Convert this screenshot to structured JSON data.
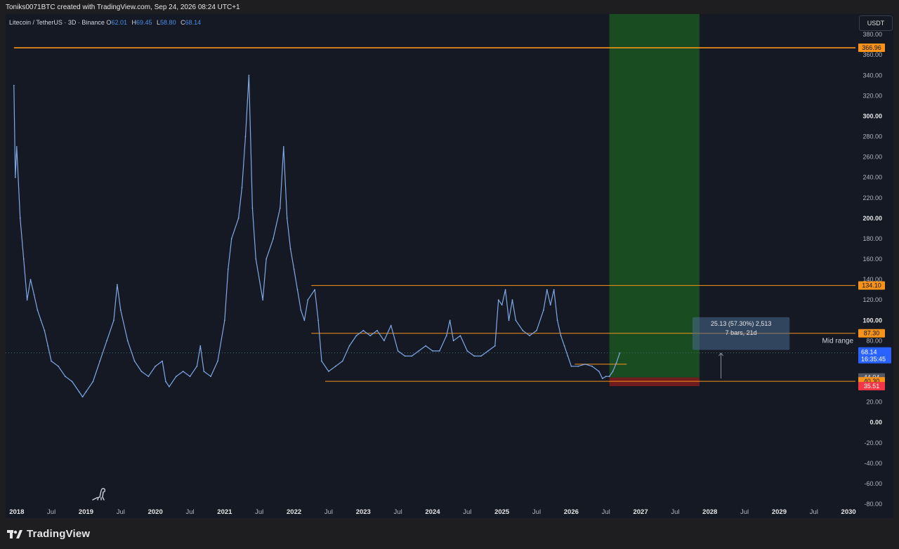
{
  "header": {
    "attribution": "Toniks0071BTC created with TradingView.com, Sep 24, 2026 08:24 UTC+1"
  },
  "legend": {
    "symbol": "Litecoin / TetherUS · 3D · Binance",
    "open_label": "O",
    "open": "62.01",
    "high_label": "H",
    "high": "69.45",
    "low_label": "L",
    "low": "58.80",
    "close_label": "C",
    "close": "68.14"
  },
  "currency_button": "USDT",
  "brand": {
    "name": "TradingView",
    "icon": "tradingview-logo-icon"
  },
  "dino_icon": "dinosaur-icon",
  "chart_data": {
    "type": "line",
    "title": "Litecoin / TetherUS · 3D · Binance",
    "ylim": [
      -80,
      400
    ],
    "xlim": [
      2017.84,
      2030.1
    ],
    "y_ticks": [
      -80,
      -60,
      -40,
      -20,
      0,
      20,
      40,
      60,
      80,
      100,
      120,
      140,
      160,
      180,
      200,
      220,
      240,
      260,
      280,
      300,
      320,
      340,
      360,
      380
    ],
    "x_ticks": [
      {
        "t": 2018.0,
        "label": "2018",
        "bold": true
      },
      {
        "t": 2018.5,
        "label": "Jul",
        "bold": false
      },
      {
        "t": 2019.0,
        "label": "2019",
        "bold": true
      },
      {
        "t": 2019.5,
        "label": "Jul",
        "bold": false
      },
      {
        "t": 2020.0,
        "label": "2020",
        "bold": true
      },
      {
        "t": 2020.5,
        "label": "Jul",
        "bold": false
      },
      {
        "t": 2021.0,
        "label": "2021",
        "bold": true
      },
      {
        "t": 2021.5,
        "label": "Jul",
        "bold": false
      },
      {
        "t": 2022.0,
        "label": "2022",
        "bold": true
      },
      {
        "t": 2022.5,
        "label": "Jul",
        "bold": false
      },
      {
        "t": 2023.0,
        "label": "2023",
        "bold": true
      },
      {
        "t": 2023.5,
        "label": "Jul",
        "bold": false
      },
      {
        "t": 2024.0,
        "label": "2024",
        "bold": true
      },
      {
        "t": 2024.5,
        "label": "Jul",
        "bold": false
      },
      {
        "t": 2025.0,
        "label": "2025",
        "bold": true
      },
      {
        "t": 2025.5,
        "label": "Jul",
        "bold": false
      },
      {
        "t": 2026.0,
        "label": "2026",
        "bold": true
      },
      {
        "t": 2026.5,
        "label": "Jul",
        "bold": false
      },
      {
        "t": 2027.0,
        "label": "2027",
        "bold": true
      },
      {
        "t": 2027.5,
        "label": "Jul",
        "bold": false
      },
      {
        "t": 2028.0,
        "label": "2028",
        "bold": true
      },
      {
        "t": 2028.5,
        "label": "Jul",
        "bold": false
      },
      {
        "t": 2029.0,
        "label": "2029",
        "bold": true
      },
      {
        "t": 2029.5,
        "label": "Jul",
        "bold": false
      },
      {
        "t": 2030.0,
        "label": "2030",
        "bold": true
      }
    ],
    "series": [
      {
        "color": "#7fa9e6",
        "points": [
          [
            2017.96,
            330
          ],
          [
            2017.98,
            240
          ],
          [
            2018.0,
            270
          ],
          [
            2018.05,
            200
          ],
          [
            2018.1,
            160
          ],
          [
            2018.15,
            120
          ],
          [
            2018.2,
            140
          ],
          [
            2018.25,
            125
          ],
          [
            2018.3,
            110
          ],
          [
            2018.35,
            100
          ],
          [
            2018.4,
            90
          ],
          [
            2018.45,
            75
          ],
          [
            2018.5,
            60
          ],
          [
            2018.6,
            55
          ],
          [
            2018.7,
            45
          ],
          [
            2018.8,
            40
          ],
          [
            2018.9,
            30
          ],
          [
            2018.95,
            25
          ],
          [
            2019.0,
            30
          ],
          [
            2019.1,
            40
          ],
          [
            2019.2,
            60
          ],
          [
            2019.3,
            80
          ],
          [
            2019.4,
            100
          ],
          [
            2019.45,
            135
          ],
          [
            2019.5,
            110
          ],
          [
            2019.6,
            80
          ],
          [
            2019.7,
            60
          ],
          [
            2019.8,
            50
          ],
          [
            2019.9,
            45
          ],
          [
            2020.0,
            55
          ],
          [
            2020.1,
            60
          ],
          [
            2020.15,
            40
          ],
          [
            2020.2,
            35
          ],
          [
            2020.3,
            45
          ],
          [
            2020.4,
            50
          ],
          [
            2020.5,
            45
          ],
          [
            2020.6,
            55
          ],
          [
            2020.65,
            75
          ],
          [
            2020.7,
            50
          ],
          [
            2020.8,
            45
          ],
          [
            2020.9,
            60
          ],
          [
            2021.0,
            100
          ],
          [
            2021.05,
            150
          ],
          [
            2021.1,
            180
          ],
          [
            2021.2,
            200
          ],
          [
            2021.25,
            230
          ],
          [
            2021.3,
            280
          ],
          [
            2021.35,
            340
          ],
          [
            2021.4,
            210
          ],
          [
            2021.45,
            160
          ],
          [
            2021.55,
            120
          ],
          [
            2021.6,
            160
          ],
          [
            2021.7,
            180
          ],
          [
            2021.8,
            210
          ],
          [
            2021.85,
            270
          ],
          [
            2021.9,
            200
          ],
          [
            2021.95,
            170
          ],
          [
            2022.0,
            150
          ],
          [
            2022.05,
            130
          ],
          [
            2022.1,
            110
          ],
          [
            2022.15,
            100
          ],
          [
            2022.2,
            120
          ],
          [
            2022.3,
            130
          ],
          [
            2022.35,
            100
          ],
          [
            2022.4,
            60
          ],
          [
            2022.5,
            50
          ],
          [
            2022.6,
            55
          ],
          [
            2022.7,
            60
          ],
          [
            2022.8,
            75
          ],
          [
            2022.9,
            85
          ],
          [
            2023.0,
            90
          ],
          [
            2023.1,
            85
          ],
          [
            2023.2,
            90
          ],
          [
            2023.3,
            80
          ],
          [
            2023.4,
            95
          ],
          [
            2023.5,
            70
          ],
          [
            2023.6,
            65
          ],
          [
            2023.7,
            65
          ],
          [
            2023.8,
            70
          ],
          [
            2023.9,
            75
          ],
          [
            2024.0,
            70
          ],
          [
            2024.1,
            70
          ],
          [
            2024.2,
            85
          ],
          [
            2024.25,
            100
          ],
          [
            2024.3,
            80
          ],
          [
            2024.4,
            85
          ],
          [
            2024.5,
            70
          ],
          [
            2024.6,
            65
          ],
          [
            2024.7,
            65
          ],
          [
            2024.8,
            70
          ],
          [
            2024.9,
            75
          ],
          [
            2024.95,
            120
          ],
          [
            2025.0,
            115
          ],
          [
            2025.05,
            130
          ],
          [
            2025.1,
            100
          ],
          [
            2025.15,
            120
          ],
          [
            2025.2,
            100
          ],
          [
            2025.3,
            90
          ],
          [
            2025.4,
            85
          ],
          [
            2025.5,
            90
          ],
          [
            2025.6,
            110
          ],
          [
            2025.65,
            130
          ],
          [
            2025.7,
            115
          ],
          [
            2025.75,
            130
          ],
          [
            2025.8,
            100
          ],
          [
            2025.85,
            85
          ],
          [
            2025.9,
            75
          ],
          [
            2025.95,
            65
          ],
          [
            2026.0,
            55
          ],
          [
            2026.1,
            55
          ],
          [
            2026.2,
            57
          ],
          [
            2026.3,
            55
          ],
          [
            2026.4,
            50
          ],
          [
            2026.45,
            43
          ],
          [
            2026.5,
            45
          ],
          [
            2026.55,
            45
          ],
          [
            2026.6,
            50
          ],
          [
            2026.65,
            58
          ],
          [
            2026.7,
            68
          ]
        ]
      }
    ],
    "lines": [
      {
        "y": 366.96,
        "label": "366.96",
        "x0": 2017.96,
        "x1": 2030.1
      },
      {
        "y": 134.1,
        "label": "134.10",
        "x0": 2022.25,
        "x1": 2030.1
      },
      {
        "y": 87.3,
        "label": "87.30",
        "x0": 2022.25,
        "x1": 2030.1
      },
      {
        "y": 40.3,
        "label": "40.30",
        "x0": 2022.45,
        "x1": 2030.1
      },
      {
        "y": 57,
        "label": "",
        "x0": 2026.05,
        "x1": 2026.8
      }
    ],
    "price_labels": [
      {
        "y": 366.96,
        "text": "366.96",
        "bg": "#f7931a",
        "color": "#131722"
      },
      {
        "y": 134.1,
        "text": "134.10",
        "bg": "#f7931a",
        "color": "#131722"
      },
      {
        "y": 87.3,
        "text": "87.30",
        "bg": "#f7931a",
        "color": "#131722"
      },
      {
        "y": 44.04,
        "text": "44.04",
        "bg": "#555862",
        "color": "#e6e6e6"
      },
      {
        "y": 40.3,
        "text": "40.30",
        "bg": "#f7931a",
        "color": "#131722"
      },
      {
        "y": 35.51,
        "text": "35.51",
        "bg": "#f23645",
        "color": "#ffffff"
      }
    ],
    "current_price": {
      "y": 68.14,
      "price": "68.14",
      "countdown": "16:35:45",
      "bg": "#2962ff"
    },
    "position_zones": {
      "x0": 2026.55,
      "x1": 2027.85,
      "entry": 44.04,
      "target": 400,
      "stop": 35.51,
      "profit_color": "#1b5e20",
      "loss_color": "#7f1d1d"
    },
    "annotations": {
      "mid_range": {
        "text": "Mid range",
        "y": 80,
        "t": 2029.35
      },
      "measure_box": {
        "line1": "25.13 (57.30%) 2,513",
        "line2": "7 bars, 21d",
        "t0": 2027.75,
        "t1": 2029.15,
        "y0": 103,
        "y1": 71
      },
      "arrow": {
        "t": 2028.16,
        "y0": 43,
        "y1": 68
      }
    },
    "grid": false,
    "legend_position": "top-left",
    "colors": {
      "accent": "#f7931a",
      "line": "#7fa9e6"
    }
  }
}
